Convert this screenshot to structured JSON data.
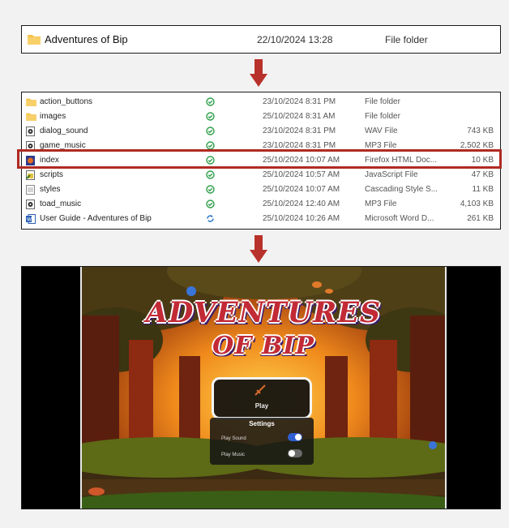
{
  "folder": {
    "name": "Adventures of Bip",
    "date": "22/10/2024 13:28",
    "type": "File folder",
    "icon": "folder-icon"
  },
  "files": [
    {
      "name": "action_buttons",
      "icon": "folder-icon",
      "status": "synced",
      "date": "23/10/2024 8:31 PM",
      "type": "File folder",
      "size": ""
    },
    {
      "name": "images",
      "icon": "folder-icon",
      "status": "synced",
      "date": "25/10/2024 8:31 AM",
      "type": "File folder",
      "size": ""
    },
    {
      "name": "dialog_sound",
      "icon": "audio-file-icon",
      "status": "synced",
      "date": "23/10/2024 8:31 PM",
      "type": "WAV File",
      "size": "743 KB"
    },
    {
      "name": "game_music",
      "icon": "audio-file-icon",
      "status": "synced",
      "date": "23/10/2024 8:31 PM",
      "type": "MP3 File",
      "size": "2,502 KB"
    },
    {
      "name": "index",
      "icon": "html-file-icon",
      "status": "synced",
      "date": "25/10/2024 10:07 AM",
      "type": "Firefox HTML Doc...",
      "size": "10 KB"
    },
    {
      "name": "scripts",
      "icon": "script-file-icon",
      "status": "synced",
      "date": "25/10/2024 10:57 AM",
      "type": "JavaScript File",
      "size": "47 KB"
    },
    {
      "name": "styles",
      "icon": "css-file-icon",
      "status": "synced",
      "date": "25/10/2024 10:07 AM",
      "type": "Cascading Style S...",
      "size": "11 KB"
    },
    {
      "name": "toad_music",
      "icon": "audio-file-icon",
      "status": "synced",
      "date": "25/10/2024 12:40 AM",
      "type": "MP3 File",
      "size": "4,103 KB"
    },
    {
      "name": "User Guide - Adventures of Bip",
      "icon": "word-file-icon",
      "status": "syncing",
      "date": "25/10/2024 10:26 AM",
      "type": "Microsoft Word D...",
      "size": "261 KB"
    }
  ],
  "highlighted_file": "index",
  "game": {
    "title_line1": "ADVENTURES",
    "title_line2": "OF BIP",
    "play_label": "Play",
    "settings_title": "Settings",
    "options": [
      {
        "label": "Play Sound",
        "enabled": true
      },
      {
        "label": "Play Music",
        "enabled": false
      }
    ]
  },
  "colors": {
    "accent_red": "#b02a22",
    "arrow_red": "#b8312a",
    "sync_green": "#2e9e4a",
    "sync_blue": "#1f6fc4",
    "toggle_on": "#2f5fd0",
    "toggle_off": "#6a6a6a",
    "folder_yellow": "#f5c44e"
  }
}
